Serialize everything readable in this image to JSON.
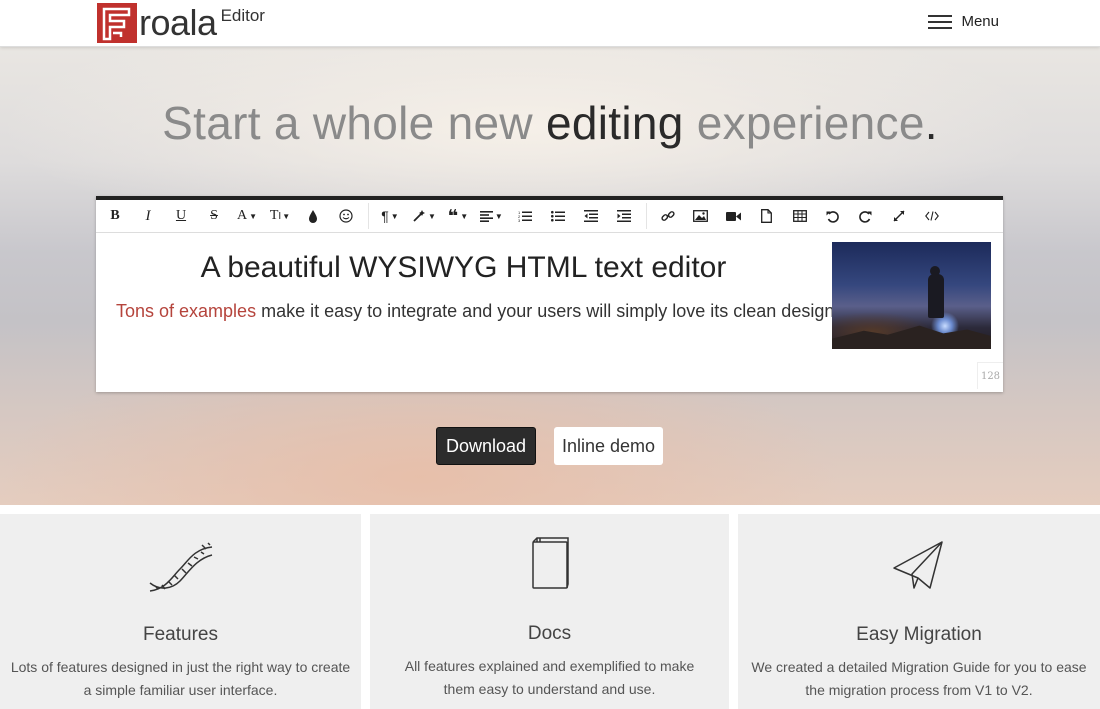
{
  "header": {
    "logo_word": "roala",
    "logo_sub": "Editor",
    "menu_label": "Menu"
  },
  "hero": {
    "headline_part1": "Start a whole new ",
    "headline_strong": "editing",
    "headline_part2": " experience",
    "headline_dot": "."
  },
  "editor": {
    "toolbar": [
      "bold",
      "italic",
      "underline",
      "strikethrough",
      "font-family",
      "font-size",
      "color",
      "emoticons",
      "paragraph-format",
      "paragraph-style",
      "quote",
      "align",
      "ordered-list",
      "unordered-list",
      "outdent",
      "indent",
      "insert-link",
      "insert-image",
      "insert-video",
      "insert-file",
      "insert-table",
      "undo",
      "redo",
      "fullscreen",
      "html-view"
    ],
    "title": "A beautiful WYSIWYG HTML text editor",
    "link_text": "Tons of examples",
    "body_text": " make it easy to integrate and your users will simply love its clean design.",
    "char_count": "128"
  },
  "buttons": {
    "download": "Download",
    "inline_demo": "Inline demo"
  },
  "cards": [
    {
      "icon": "dna-icon",
      "title": "Features",
      "desc": "Lots of features designed in just the right way to create a simple familiar user interface."
    },
    {
      "icon": "book-icon",
      "title": "Docs",
      "desc": "All features explained and exemplified to make them easy to understand and use."
    },
    {
      "icon": "paper-plane-icon",
      "title": "Easy Migration",
      "desc": "We created a detailed Migration Guide for you to ease the migration process from V1 to V2."
    }
  ],
  "colors": {
    "brand": "#c0312d",
    "link": "#b5443c",
    "dark_button": "#2c2c2c"
  }
}
